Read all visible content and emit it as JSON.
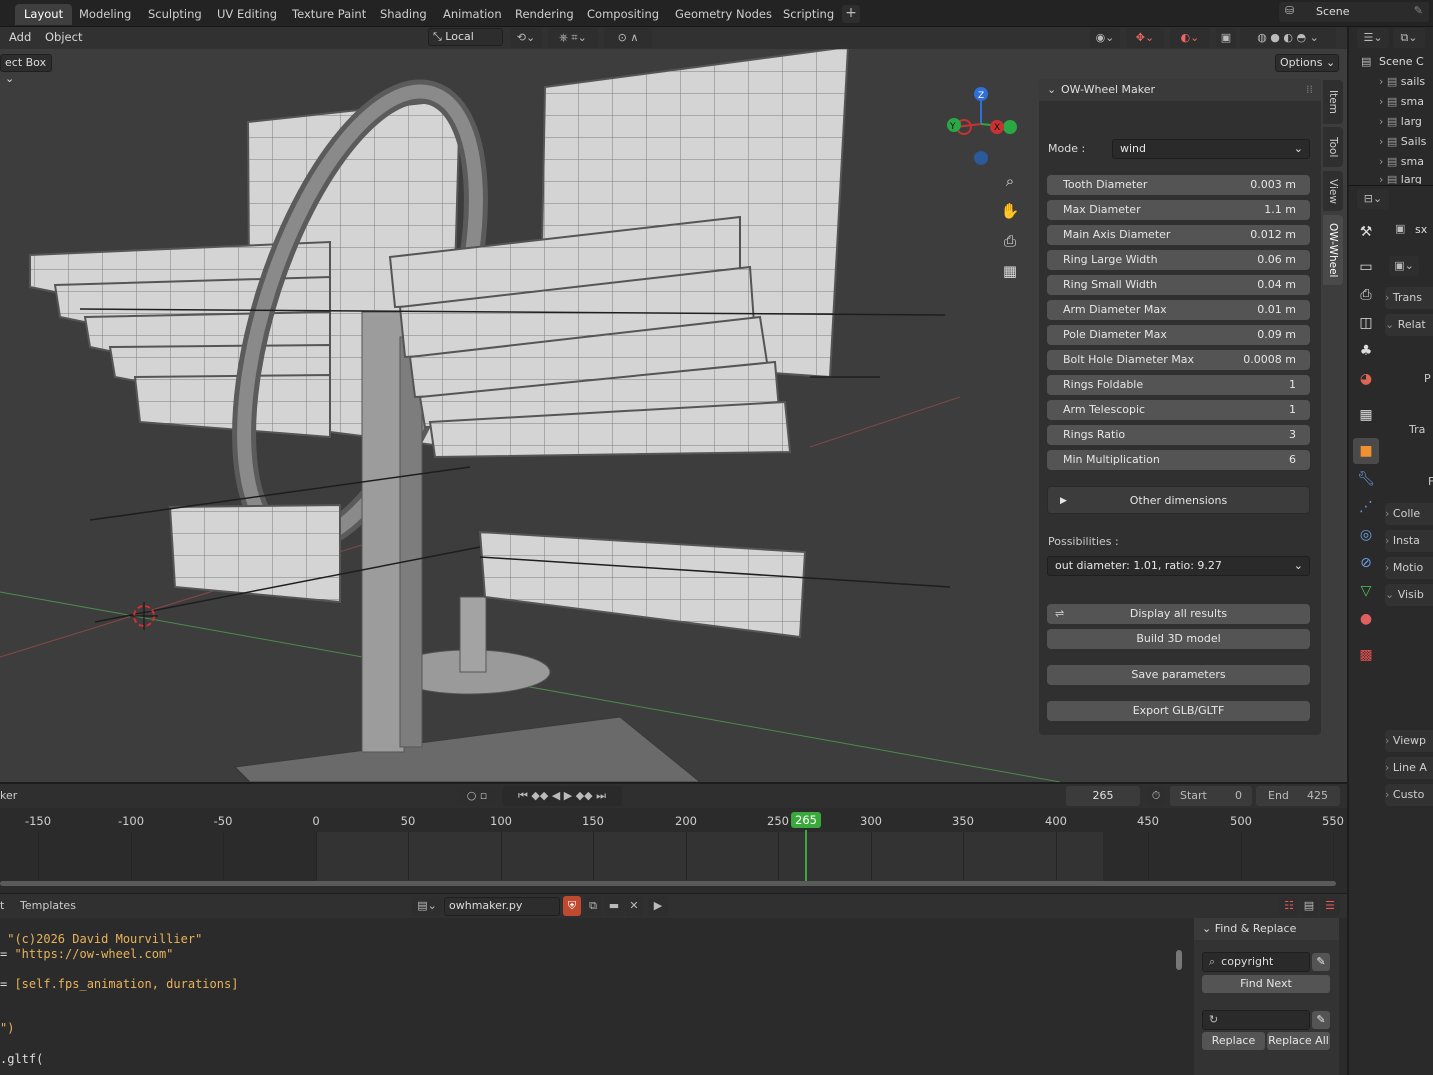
{
  "workspace_tabs": [
    "Layout",
    "Modeling",
    "Sculpting",
    "UV Editing",
    "Texture Paint",
    "Shading",
    "Animation",
    "Rendering",
    "Compositing",
    "Geometry Nodes",
    "Scripting"
  ],
  "scene_label": "Scene",
  "viewport": {
    "menus": [
      "Add",
      "Object"
    ],
    "select_box": "ect Box",
    "orientation": "Local",
    "options_label": "Options"
  },
  "gizmo": {
    "z": "Z",
    "y": "Y",
    "x": "X"
  },
  "npanel": {
    "title": "OW-Wheel Maker",
    "mode_label": "Mode :",
    "mode_value": "wind",
    "fields": [
      {
        "label": "Tooth Diameter",
        "value": "0.003 m"
      },
      {
        "label": "Max Diameter",
        "value": "1.1 m"
      },
      {
        "label": "Main Axis Diameter",
        "value": "0.012 m"
      },
      {
        "label": "Ring Large Width",
        "value": "0.06 m"
      },
      {
        "label": "Ring Small Width",
        "value": "0.04 m"
      },
      {
        "label": "Arm Diameter Max",
        "value": "0.01 m"
      },
      {
        "label": "Pole Diameter Max",
        "value": "0.09 m"
      },
      {
        "label": "Bolt Hole Diameter Max",
        "value": "0.0008 m"
      },
      {
        "label": "Rings Foldable",
        "value": "1"
      },
      {
        "label": "Arm Telescopic",
        "value": "1"
      },
      {
        "label": "Rings Ratio",
        "value": "3"
      },
      {
        "label": "Min Multiplication",
        "value": "6"
      }
    ],
    "other_dimensions": "Other dimensions",
    "possibilities_label": "Possibilities :",
    "possibilities_value": "out diameter: 1.01, ratio: 9.27",
    "display_all": "Display all results",
    "build": "Build 3D model",
    "save": "Save parameters",
    "export": "Export GLB/GLTF",
    "side_tabs": [
      "Item",
      "Tool",
      "View",
      "OW-Wheel"
    ]
  },
  "outliner": {
    "title": "Scene C",
    "rows": [
      "sails",
      "sma",
      "larg",
      "Sails",
      "sma",
      "larg"
    ]
  },
  "properties": {
    "object_name": "sx",
    "sections": [
      "Trans",
      "Relat",
      "Colle",
      "Insta",
      "Motio",
      "Visib",
      "Viewp",
      "Line A",
      "Custo"
    ],
    "labels": [
      "P",
      "Tra",
      "F"
    ]
  },
  "timeline": {
    "left_label": "ker",
    "current_frame": "265",
    "start_label": "Start",
    "start_value": "0",
    "end_label": "End",
    "end_value": "425",
    "ticks": [
      "-150",
      "-100",
      "-50",
      "0",
      "50",
      "100",
      "150",
      "200",
      "250",
      "265",
      "300",
      "350",
      "400",
      "450",
      "500",
      "550"
    ]
  },
  "text_editor": {
    "left_label": "t",
    "templates": "Templates",
    "filename": "owhmaker.py",
    "code_lines": [
      {
        "prefix": "",
        "text": " \"(c)2026 David Mourvillier\""
      },
      {
        "prefix": "= ",
        "text": "\"https://ow-wheel.com\""
      },
      {
        "prefix": "",
        "text": ""
      },
      {
        "prefix": "= ",
        "text": "[self.fps_animation, durations]"
      },
      {
        "prefix": "",
        "text": ""
      },
      {
        "prefix": "",
        "text": ""
      },
      {
        "prefix": "",
        "text": "\")"
      },
      {
        "prefix": "",
        "text": ""
      },
      {
        "prefix": "",
        "text": ".gltf("
      }
    ],
    "find_replace": {
      "title": "Find & Replace",
      "find_value": "copyright",
      "find_next": "Find Next",
      "replace": "Replace",
      "replace_all": "Replace All"
    }
  },
  "colors": {
    "accent": "#4772b3",
    "frame_marker": "#3aa83a",
    "code_text": "#e8b35a"
  }
}
